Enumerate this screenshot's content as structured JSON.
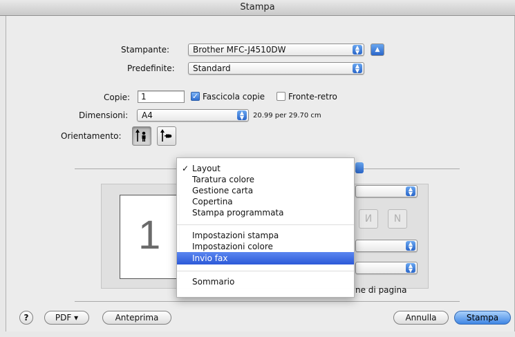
{
  "window": {
    "title": "Stampa"
  },
  "printer": {
    "label": "Stampante:",
    "value": "Brother MFC-J4510DW"
  },
  "presets": {
    "label": "Predefinite:",
    "value": "Standard"
  },
  "copies": {
    "label": "Copie:",
    "value": "1",
    "collate_label": "Fascicola copie",
    "collate_checked": true,
    "duplex_label": "Fronte-retro",
    "duplex_checked": false
  },
  "paper": {
    "label": "Dimensioni:",
    "value": "A4",
    "size_text": "20.99 per 29.70 cm"
  },
  "orientation": {
    "label": "Orientamento:",
    "options": [
      "portrait-icon",
      "landscape-icon"
    ],
    "selected": "portrait-icon"
  },
  "preview": {
    "page_number": "1"
  },
  "menu": {
    "groups": [
      [
        "Layout",
        "Taratura colore",
        "Gestione carta",
        "Copertina",
        "Stampa programmata"
      ],
      [
        "Impostazioni stampa",
        "Impostazioni colore",
        "Invio fax"
      ],
      [
        "Sommario"
      ]
    ],
    "checked": "Layout",
    "highlighted": "Invio fax"
  },
  "partial_label": "ne di pagina",
  "footer": {
    "help": "?",
    "pdf": "PDF ▾",
    "preview": "Anteprima",
    "cancel": "Annulla",
    "print": "Stampa"
  },
  "colors": {
    "highlight": "#2c59d8",
    "default_button": "#3f86e4",
    "stepper": "#2a66c9"
  }
}
